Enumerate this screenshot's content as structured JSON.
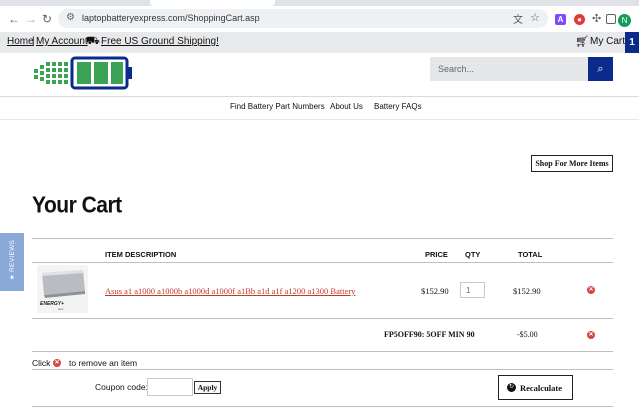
{
  "browser": {
    "url": "laptopbatteryexpress.com/ShoppingCart.asp",
    "profile_initial": "N",
    "ext_a": "A"
  },
  "topbar": {
    "home": "Home",
    "separator": "|",
    "account": "My Account",
    "shipping": "Free US Ground Shipping!",
    "cart": "My Cart",
    "cart_count": "1"
  },
  "search": {
    "placeholder": "Search..."
  },
  "menu": [
    "Find Battery Part Numbers",
    "About Us",
    "Battery FAQs"
  ],
  "shop_more": "Shop For More Items",
  "page_title": "Your Cart",
  "table": {
    "headers": {
      "description": "ITEM DESCRIPTION",
      "price": "PRICE",
      "qty": "QTY",
      "total": "TOTAL"
    },
    "item": {
      "name": "Asus a1 a1000 a1000b a1000d a1000f a1Bb a1d a1f a1200 a1300 Battery",
      "price": "$152.90",
      "qty": "1",
      "total": "$152.90",
      "thumb_brand": "ENERGY+",
      "thumb_sub": "plus"
    },
    "coupon_line": {
      "name": "FP5OFF90: 5OFF MIN 90",
      "value": "-$5.00"
    }
  },
  "remove_hint": {
    "before": "Click",
    "after": "to remove an item"
  },
  "coupon": {
    "label": "Coupon code:",
    "apply": "Apply"
  },
  "recalculate": "Recalculate",
  "reviews_tab": "★ REVIEWS",
  "colors": {
    "brand_blue": "#0a2a8c",
    "logo_green": "#3aa356",
    "remove_red": "#d64541",
    "link_red": "#c0392b"
  }
}
